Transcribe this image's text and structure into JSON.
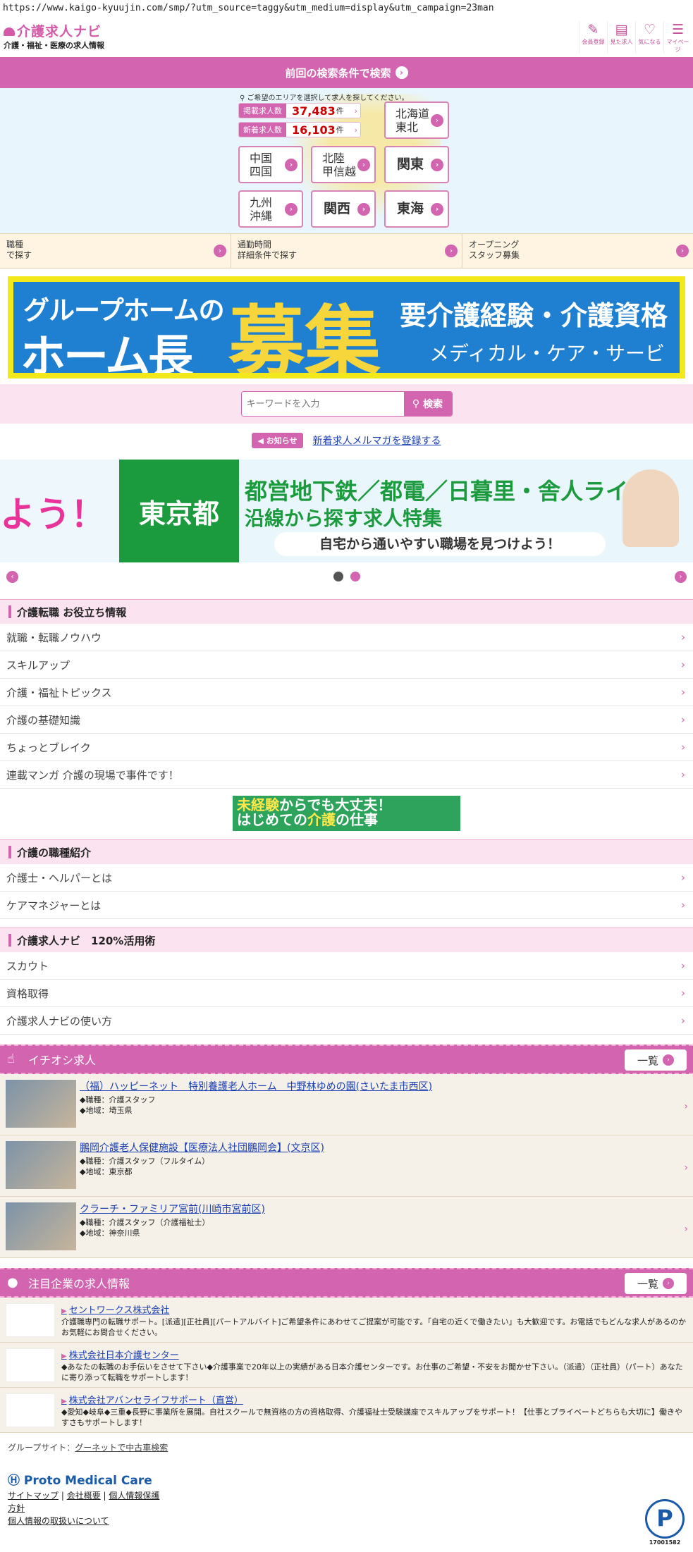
{
  "url": "https://www.kaigo-kyuujin.com/smp/?utm_source=taggy&utm_medium=display&utm_campaign=23man",
  "header": {
    "logo": "介護求人ナビ",
    "tagline": "介護・福祉・医療の求人情報",
    "nav": [
      {
        "label": "会員登録",
        "icon": "pencil-icon",
        "glyph": "✎"
      },
      {
        "label": "見た求人",
        "icon": "calendar-icon",
        "glyph": "▤"
      },
      {
        "label": "気になる",
        "icon": "heart-icon",
        "glyph": "♡"
      },
      {
        "label": "マイページ",
        "icon": "mypage-icon",
        "glyph": "☰"
      }
    ]
  },
  "prev_search": "前回の検索条件で検索",
  "area": {
    "hint": "ご希望のエリアを選択して求人を探してください。",
    "total_label": "掲載求人数",
    "total_value": "37,483",
    "new_label": "新着求人数",
    "new_value": "16,103",
    "unit": "件",
    "regions": [
      "北海道\n東北",
      "中国\n四国",
      "北陸\n甲信越",
      "関東",
      "九州\n沖縄",
      "関西",
      "東海"
    ]
  },
  "search3": [
    {
      "label": "職種\nで探す"
    },
    {
      "label": "通勤時間\n詳細条件で探す"
    },
    {
      "label": "オープニング\nスタッフ募集"
    }
  ],
  "banner1": {
    "a": "グループホームの",
    "b": "ホーム長",
    "c": "募集",
    "d": "要介護経験・介護資格",
    "e": "メディカル・ケア・サービス"
  },
  "keyword": {
    "placeholder": "キーワードを入力",
    "button": "検索"
  },
  "news": {
    "tag": "お知らせ",
    "link": "新着求人メルマガを登録する"
  },
  "slide": {
    "left": "よう！",
    "tag": "東京都",
    "t1": "都営地下鉄／都電／日暮里・舎人ライナー",
    "t2": "沿線から探す求人特集",
    "t3": "自宅から通いやすい職場を見つけよう！"
  },
  "useful": {
    "title": "介護転職 お役立ち情報",
    "items": [
      "就職・転職ノウハウ",
      "スキルアップ",
      "介護・福祉トピックス",
      "介護の基礎知識",
      "ちょっとブレイク",
      "連載マンガ 介護の現場で事件です！"
    ]
  },
  "midban": {
    "a": "未経験",
    "b": "からでも大丈夫！",
    "c": "はじめての",
    "d": "介護",
    "e": "の仕事"
  },
  "jobtypes": {
    "title": "介護の職種紹介",
    "items": [
      "介護士・ヘルパーとは",
      "ケアマネジャーとは"
    ]
  },
  "guide": {
    "title": "介護求人ナビ　120%活用術",
    "items": [
      "スカウト",
      "資格取得",
      "介護求人ナビの使い方"
    ]
  },
  "pickup": {
    "title": "イチオシ求人",
    "all": "一覧",
    "jobs": [
      {
        "title": "（福）ハッピーネット　特別養護老人ホーム　中野林ゆめの園(さいたま市西区)",
        "job": "◆職種：介護スタッフ",
        "loc": "◆地域：埼玉県"
      },
      {
        "title": "鵬岡介護老人保健施設【医療法人社団鵬岡会】(文京区)",
        "job": "◆職種：介護スタッフ（フルタイム）",
        "loc": "◆地域：東京都"
      },
      {
        "title": "クラーチ・ファミリア宮前(川崎市宮前区)",
        "job": "◆職種：介護スタッフ（介護福祉士）",
        "loc": "◆地域：神奈川県"
      }
    ]
  },
  "companies": {
    "title": "注目企業の求人情報",
    "all": "一覧",
    "items": [
      {
        "name": "セントワークス株式会社",
        "desc": "介護職専門の転職サポート。[派遣][正社員][パートアルバイト]ご希望条件にあわせてご提案が可能です。「自宅の近くで働きたい」も大歓迎です。お電話でもどんな求人があるのかお気軽にお問合せください。"
      },
      {
        "name": "株式会社日本介護センター",
        "desc": "◆あなたの転職のお手伝いをさせて下さい◆介護事業で20年以上の実績がある日本介護センターです。お仕事のご希望・不安をお聞かせ下さい。（派遣）（正社員）（パート）あなたに寄り添って転職をサポートします！"
      },
      {
        "name": "株式会社アバンセライフサポート（直営）",
        "desc": "◆愛知◆岐阜◆三重◆長野に事業所を展開。自社スクールで無資格の方の資格取得、介護福祉士受験講座でスキルアップをサポート！【仕事とプライベートどちらも大切に】働きやすさもサポートします！"
      }
    ]
  },
  "footer": {
    "group_label": "グループサイト：",
    "group_link": "グーネットで中古車検索",
    "company": "Proto Medical Care",
    "links": [
      "サイトマップ",
      "会社概要",
      "個人情報保護",
      "方針"
    ],
    "privacy": "個人情報の取扱いについて",
    "pmark_no": "17001582"
  },
  "colors": {
    "brand": "#d364af",
    "link": "#1a3fb3"
  }
}
